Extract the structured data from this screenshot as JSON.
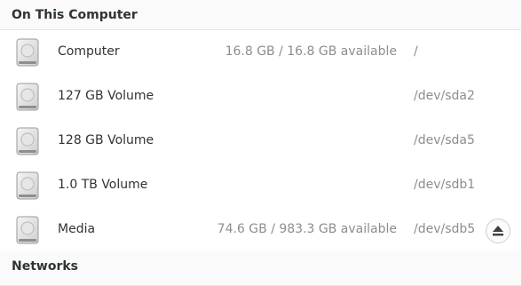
{
  "sections": {
    "local_title": "On This Computer",
    "networks_title": "Networks"
  },
  "drives": [
    {
      "name": "Computer",
      "space": "16.8 GB / 16.8 GB available",
      "path": "/",
      "icon": "drive-harddisk-icon",
      "eject": false
    },
    {
      "name": "127 GB Volume",
      "space": "",
      "path": "/dev/sda2",
      "icon": "drive-harddisk-icon",
      "eject": false
    },
    {
      "name": "128 GB Volume",
      "space": "",
      "path": "/dev/sda5",
      "icon": "drive-harddisk-icon",
      "eject": false
    },
    {
      "name": "1.0 TB Volume",
      "space": "",
      "path": "/dev/sdb1",
      "icon": "drive-harddisk-icon",
      "eject": false
    },
    {
      "name": "Media",
      "space": "74.6 GB / 983.3 GB available",
      "path": "/dev/sdb5",
      "icon": "drive-harddisk-icon",
      "eject": true
    }
  ],
  "icons": {
    "eject": "eject-icon"
  },
  "colors": {
    "text": "#2e3436",
    "secondary_text": "#8a8e8f",
    "header_bg": "#fafafa"
  }
}
